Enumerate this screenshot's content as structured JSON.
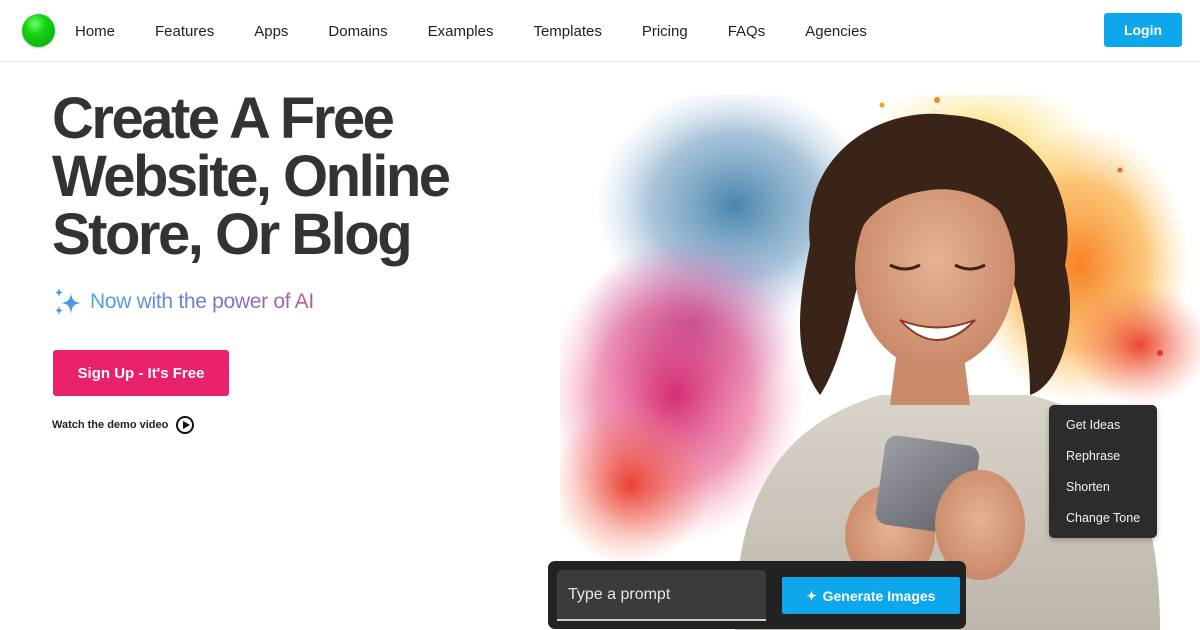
{
  "nav": {
    "logo_icon": "green-sphere-logo",
    "links": [
      "Home",
      "Features",
      "Apps",
      "Domains",
      "Examples",
      "Templates",
      "Pricing",
      "FAQs",
      "Agencies"
    ],
    "login_label": "Login"
  },
  "hero": {
    "headline": [
      "Create A Free",
      "Website, Online",
      "Store, Or Blog"
    ],
    "ai_tagline": "Now with the power of AI",
    "ai_icon": "sparkles-icon",
    "signup_label": "Sign Up - It's Free",
    "demo_label": "Watch the demo video",
    "demo_icon": "play-circle-icon",
    "image_description": "Smiling woman with curly hair looking at a smartphone in front of a colorful paint-smoke splash"
  },
  "ai_menu": {
    "items": [
      "Get Ideas",
      "Rephrase",
      "Shorten",
      "Change Tone"
    ]
  },
  "prompt_bar": {
    "placeholder": "Type a prompt",
    "value": "",
    "generate_label": "Generate Images",
    "generate_icon": "sparkle-icon"
  },
  "colors": {
    "primary_blue": "#0fa7ec",
    "signup_pink": "#e8216a",
    "headline_text": "#333333",
    "logo_green": "#16d116",
    "dark_panel": "#222222"
  }
}
